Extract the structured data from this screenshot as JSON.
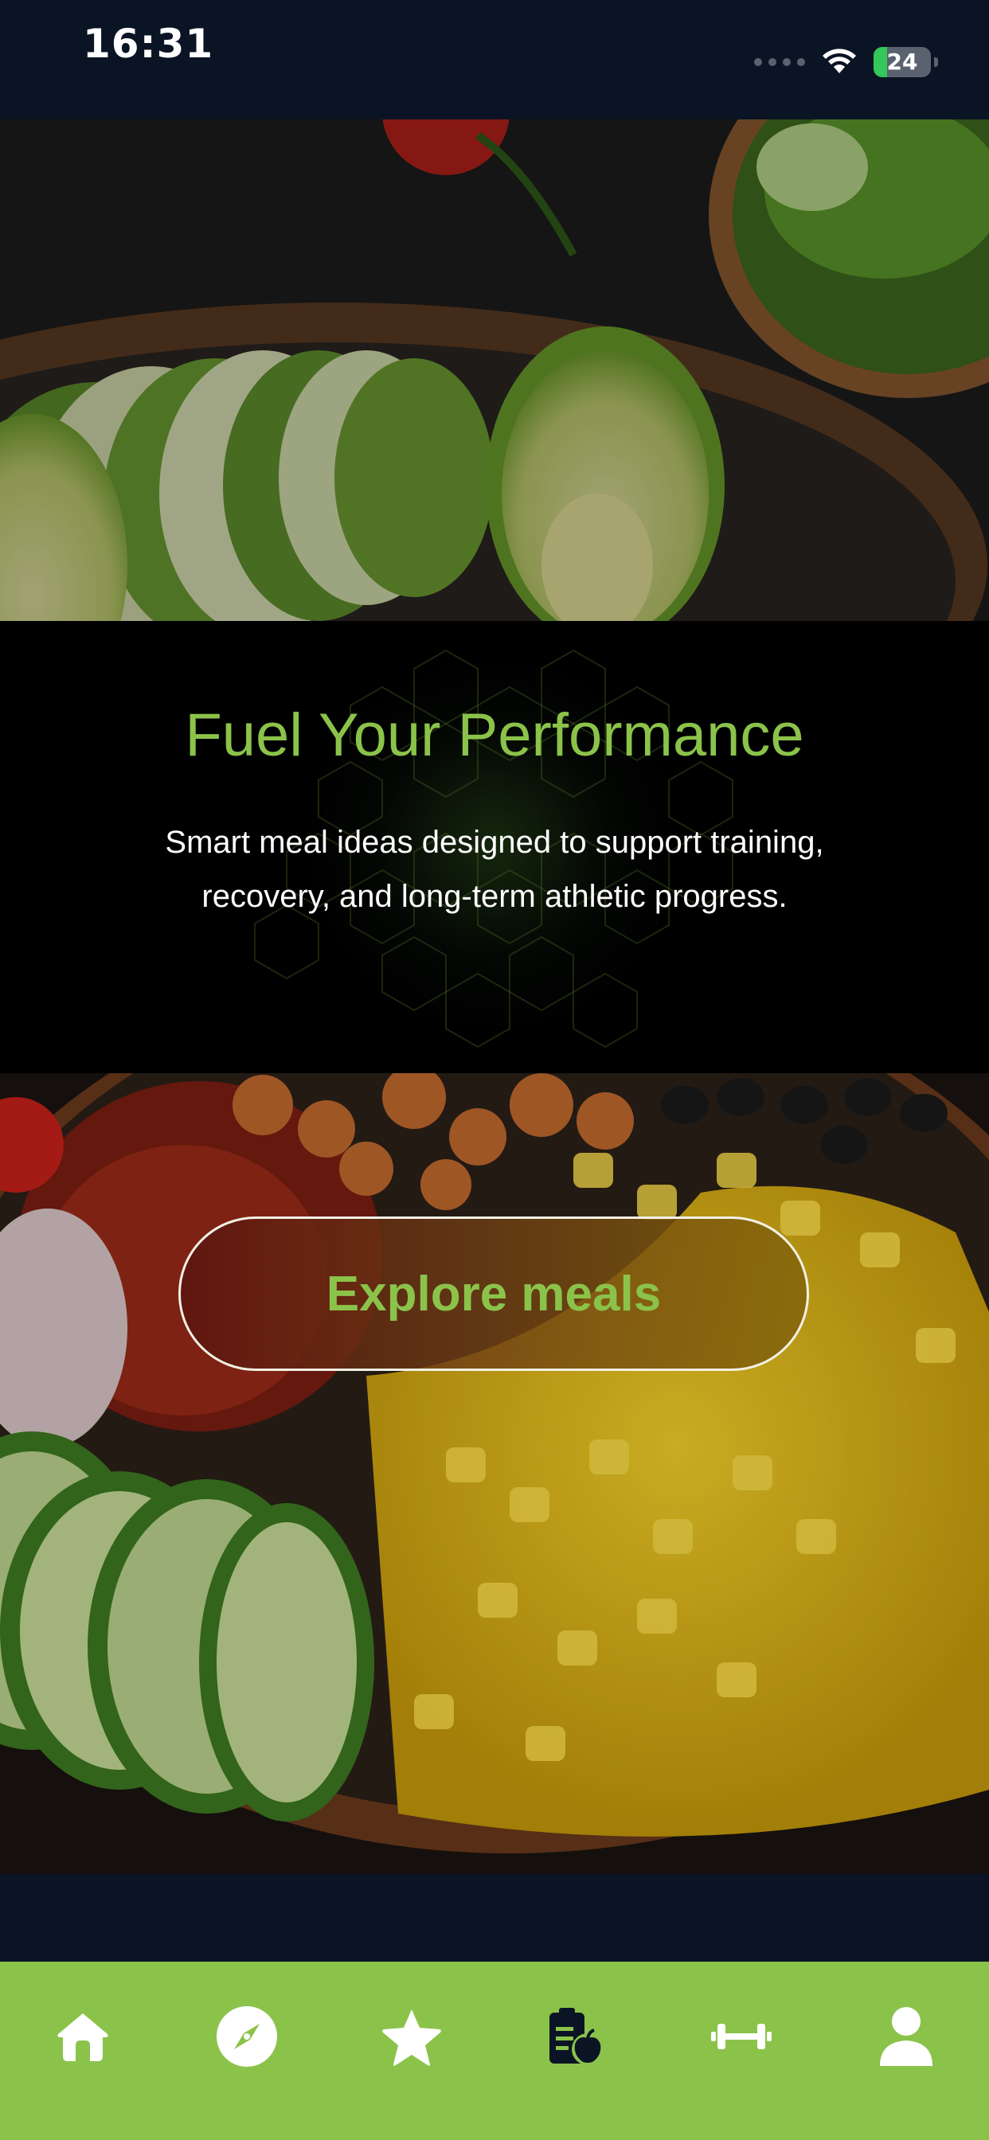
{
  "status_bar": {
    "time": "16:31",
    "battery_level": "24",
    "battery_fraction": 0.24
  },
  "hero": {
    "title": "Fuel Your Performance",
    "subtitle_line1": "Smart meal ideas designed to support training,",
    "subtitle_line2": "recovery, and long-term athletic progress."
  },
  "cta": {
    "label": "Explore meals"
  },
  "tabbar": {
    "items": [
      {
        "icon": "home-icon"
      },
      {
        "icon": "compass-icon"
      },
      {
        "icon": "star-icon"
      },
      {
        "icon": "clipboard-apple-icon"
      },
      {
        "icon": "dumbbell-icon"
      },
      {
        "icon": "person-icon"
      }
    ]
  },
  "colors": {
    "accent": "#8bc34a",
    "background": "#0b1424",
    "hero_background": "#000000",
    "tab_active": "#0b1424",
    "tab_inactive": "#ffffff"
  }
}
